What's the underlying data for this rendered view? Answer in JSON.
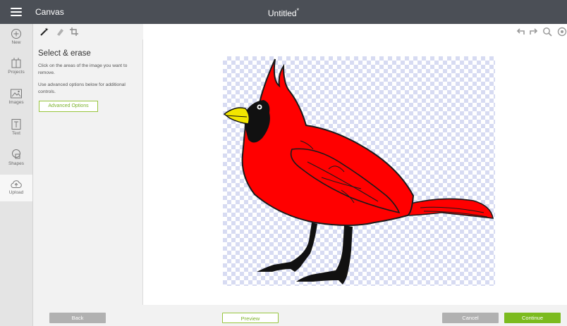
{
  "topbar": {
    "app_title": "Canvas",
    "doc_title": "Untitled",
    "unsaved_marker": "*"
  },
  "leftnav": {
    "items": [
      {
        "label": "New",
        "icon": "plus-circle-icon"
      },
      {
        "label": "Projects",
        "icon": "projects-icon"
      },
      {
        "label": "Images",
        "icon": "images-icon"
      },
      {
        "label": "Text",
        "icon": "text-icon"
      },
      {
        "label": "Shapes",
        "icon": "shapes-icon"
      },
      {
        "label": "Upload",
        "icon": "upload-cloud-icon"
      }
    ],
    "active": "Upload"
  },
  "tools": [
    {
      "name": "magic-wand-icon"
    },
    {
      "name": "eraser-icon"
    },
    {
      "name": "crop-icon"
    }
  ],
  "panel": {
    "title": "Select & erase",
    "instruction_1": "Click on the areas of the image you want to remove.",
    "instruction_2": "Use advanced options below for additional controls.",
    "advanced_label": "Advanced Options"
  },
  "actions": [
    {
      "name": "undo-icon"
    },
    {
      "name": "redo-icon"
    },
    {
      "name": "zoom-icon"
    },
    {
      "name": "settings-icon"
    }
  ],
  "bottom": {
    "back_label": "Back",
    "preview_label": "Preview",
    "cancel_label": "Cancel",
    "continue_label": "Continue"
  },
  "colors": {
    "topbar": "#4b4f56",
    "accent_green": "#7cbb1f",
    "cardinal_red": "#ff0000",
    "beak_yellow": "#f2e600",
    "checker": "#d7dbf2"
  }
}
